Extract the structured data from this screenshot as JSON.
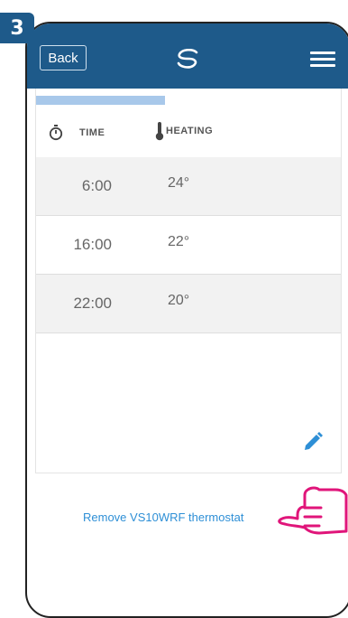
{
  "step": {
    "number": "3"
  },
  "header": {
    "back_label": "Back",
    "logo_icon": "logo-swirl-icon",
    "menu_icon": "hamburger-menu-icon",
    "bg_color": "#1e5a8a"
  },
  "schedule": {
    "progress_fraction": 0.42,
    "columns": {
      "time": "TIME",
      "heating": "HEATING"
    },
    "rows": [
      {
        "time": "6:00",
        "temp": "24°"
      },
      {
        "time": "16:00",
        "temp": "22°"
      },
      {
        "time": "22:00",
        "temp": "20°"
      }
    ],
    "edit_icon": "pencil-icon",
    "accent_color": "#2e8fd6"
  },
  "footer": {
    "remove_label": "Remove VS10WRF thermostat",
    "pointer_icon": "pointing-hand-icon",
    "pointer_color": "#e0157a"
  }
}
